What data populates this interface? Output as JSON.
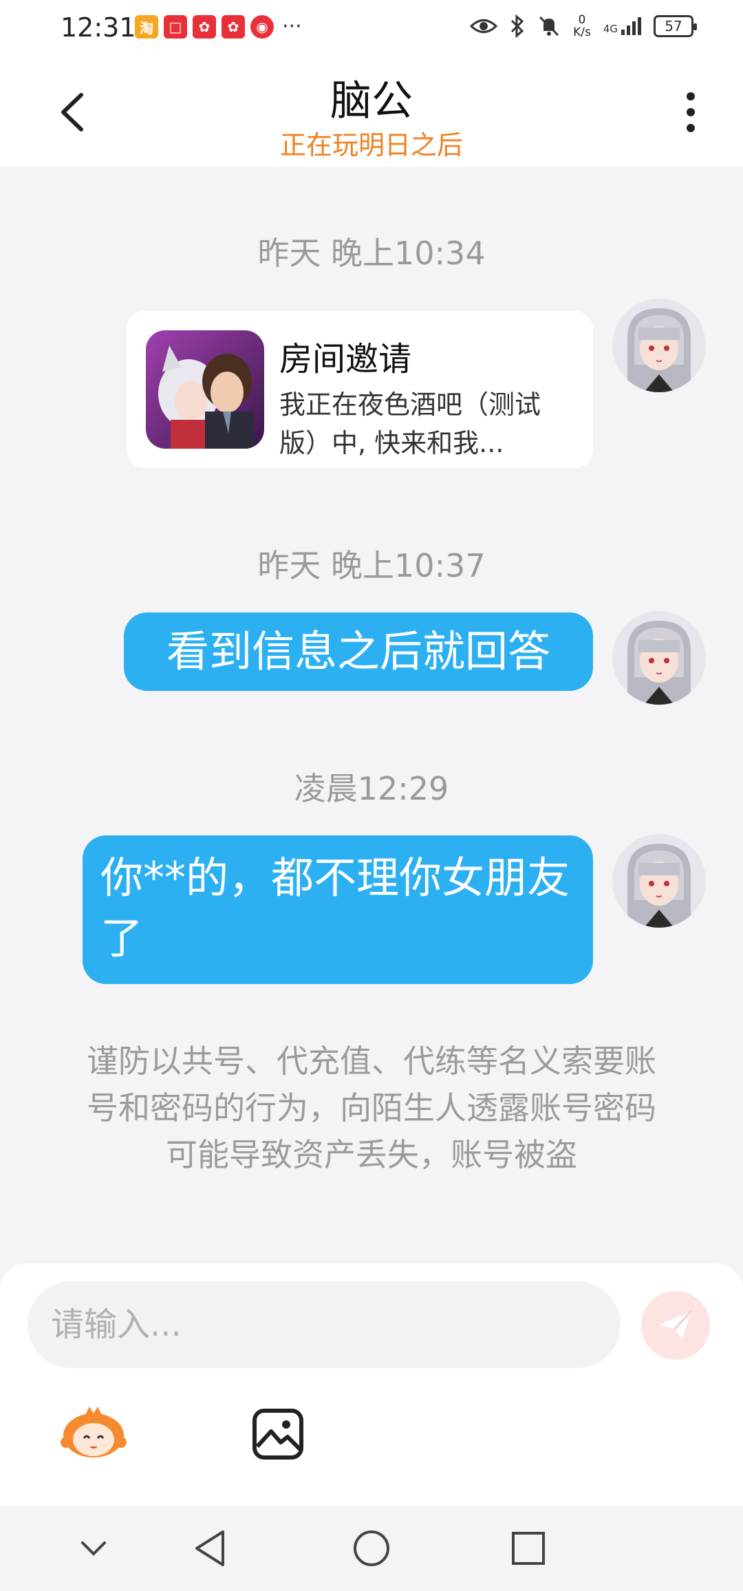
{
  "status_bar": {
    "time": "12:31",
    "notification_apps": [
      {
        "name": "taobao-app-icon",
        "glyph": "淘",
        "color": "#f5a623"
      },
      {
        "name": "book-app-icon",
        "glyph": "□",
        "color": "#e8303a"
      },
      {
        "name": "game-app-icon",
        "glyph": "✿",
        "color": "#e8303a"
      },
      {
        "name": "game-app-icon",
        "glyph": "✿",
        "color": "#e8303a"
      },
      {
        "name": "location-app-icon",
        "glyph": "◉",
        "color": "#e8303a"
      }
    ],
    "more": "···",
    "speed_value": "0",
    "speed_unit": "K/s",
    "network": "4G",
    "battery": "57"
  },
  "header": {
    "title": "脑公",
    "subtitle": "正在玩明日之后"
  },
  "messages": {
    "ts1": "昨天 晚上10:34",
    "invite_title": "房间邀请",
    "invite_desc": "我正在夜色酒吧（测试版）中, 快来和我...",
    "ts2": "昨天 晚上10:37",
    "msg1": "看到信息之后就回答",
    "ts3": "凌晨12:29",
    "msg2": "你**的，都不理你女朋友了"
  },
  "notice": "谨防以共号、代充值、代练等名义索要账号和密码的行为，向陌生人透露账号密码可能导致资产丢失，账号被盗",
  "input": {
    "placeholder": "请输入..."
  },
  "colors": {
    "accent": "#2db0f2",
    "subtitle": "#f08020",
    "send": "#fde4e2"
  }
}
